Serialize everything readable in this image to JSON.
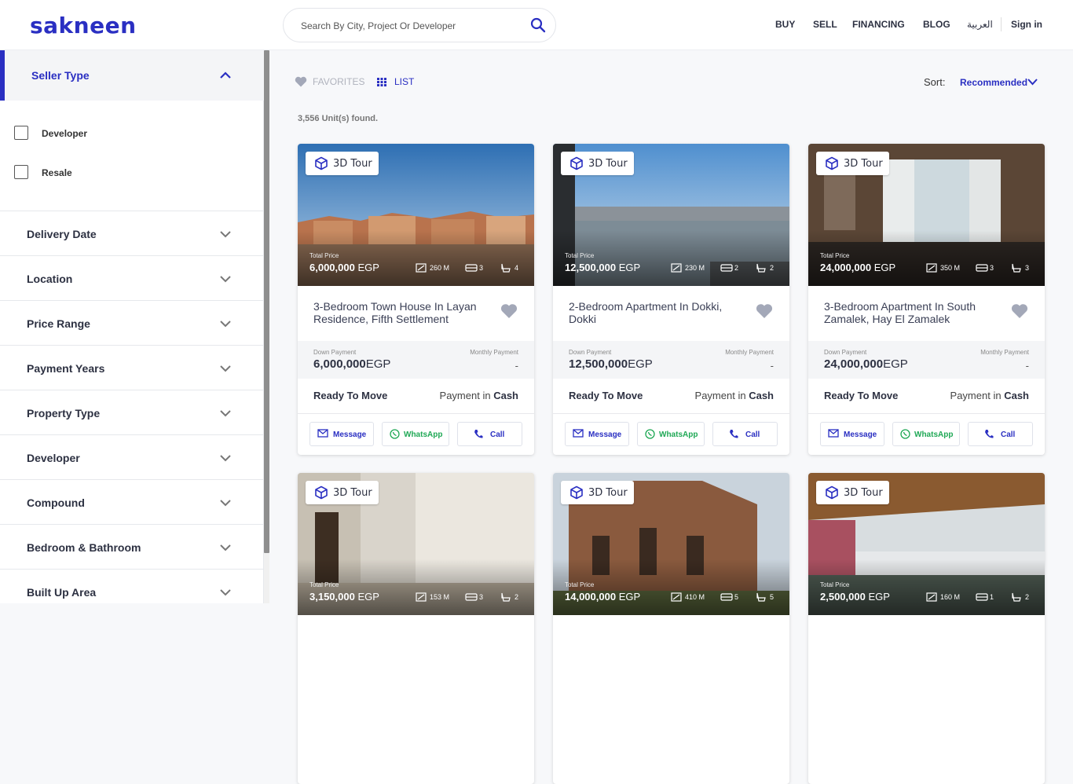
{
  "header": {
    "logo": "sakneen",
    "search_placeholder": "Search By City, Project Or Developer",
    "nav": [
      "BUY",
      "SELL",
      "FINANCING",
      "BLOG",
      "العربية",
      "Sign in"
    ]
  },
  "sidebar": {
    "seller_type": {
      "title": "Seller Type",
      "options": [
        "Developer",
        "Resale"
      ]
    },
    "filters": [
      "Delivery Date",
      "Location",
      "Price Range",
      "Payment Years",
      "Property Type",
      "Developer",
      "Compound",
      "Bedroom & Bathroom",
      "Built Up Area"
    ]
  },
  "toolbar": {
    "favorites": "FAVORITES",
    "list": "LIST",
    "sort_label": "Sort:",
    "sort_value": "Recommended",
    "units_found": "3,556 Unit(s) found."
  },
  "card_labels": {
    "tour": "3D Tour",
    "total_price": "Total Price",
    "down_payment": "Down Payment",
    "monthly_payment": "Monthly Payment",
    "message": "Message",
    "whatsapp": "WhatsApp",
    "call": "Call",
    "payment_in": "Payment in"
  },
  "listings": [
    {
      "title": "3-Bedroom Town House In Layan Residence, Fifth Settlement",
      "price": "6,000,000",
      "currency": "EGP",
      "area": "260 M",
      "beds": "3",
      "baths": "4",
      "down_payment": "6,000,000",
      "monthly_payment": "-",
      "status": "Ready To Move",
      "payment_method": "Cash"
    },
    {
      "title": "2-Bedroom Apartment In Dokki, Dokki",
      "price": "12,500,000",
      "currency": "EGP",
      "area": "230 M",
      "beds": "2",
      "baths": "2",
      "down_payment": "12,500,000",
      "monthly_payment": "-",
      "status": "Ready To Move",
      "payment_method": "Cash"
    },
    {
      "title": "3-Bedroom Apartment In South Zamalek, Hay El Zamalek",
      "price": "24,000,000",
      "currency": "EGP",
      "area": "350 M",
      "beds": "3",
      "baths": "3",
      "down_payment": "24,000,000",
      "monthly_payment": "-",
      "status": "Ready To Move",
      "payment_method": "Cash"
    },
    {
      "title": "",
      "price": "3,150,000",
      "currency": "EGP",
      "area": "153 M",
      "beds": "3",
      "baths": "2"
    },
    {
      "title": "",
      "price": "14,000,000",
      "currency": "EGP",
      "area": "410 M",
      "beds": "5",
      "baths": "5"
    },
    {
      "title": "",
      "price": "2,500,000",
      "currency": "EGP",
      "area": "160 M",
      "beds": "1",
      "baths": "2"
    }
  ],
  "colors": {
    "accent": "#2a2fc2",
    "whatsapp": "#1fa855",
    "heart": "#a3a8b8"
  }
}
